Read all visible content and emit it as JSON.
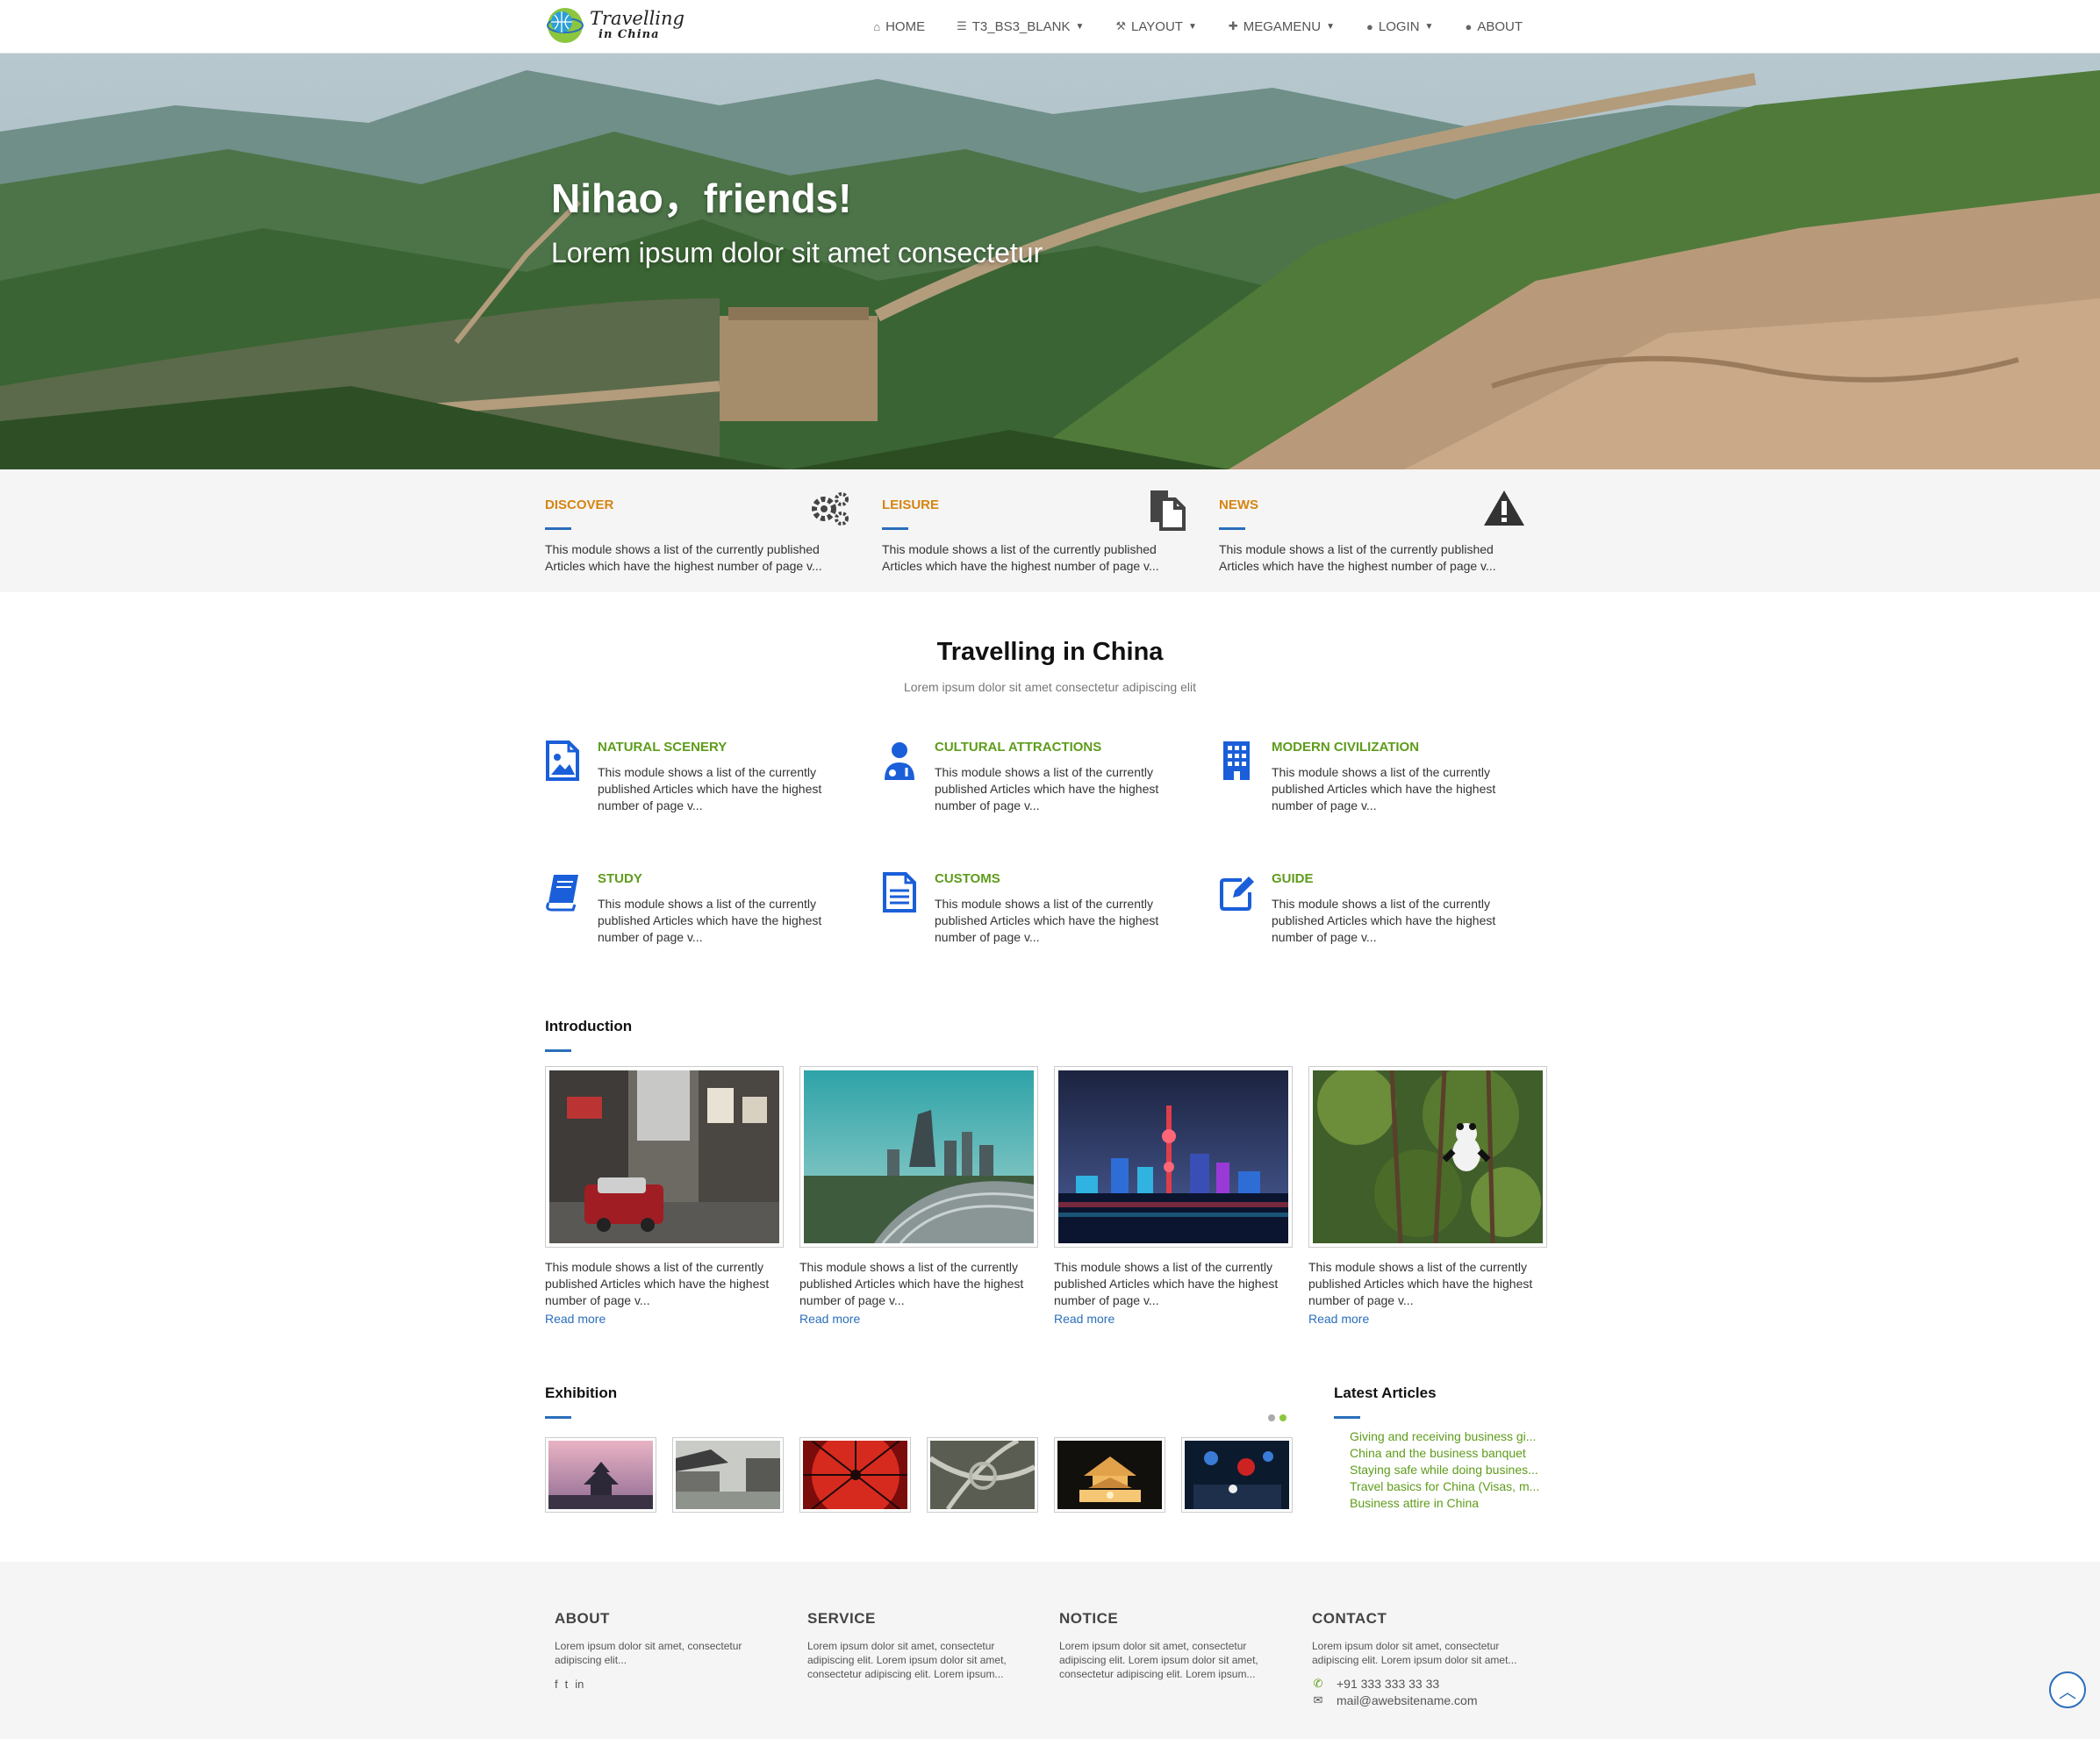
{
  "header": {
    "logo_line1": "Travelling",
    "logo_line2": "in China",
    "nav": [
      {
        "label": "HOME",
        "icon": "home-icon"
      },
      {
        "label": "T3_BS3_BLANK",
        "icon": "list-icon"
      },
      {
        "label": "LAYOUT",
        "icon": "wrench-icon"
      },
      {
        "label": "MEGAMENU",
        "icon": "gift-icon"
      },
      {
        "label": "LOGIN",
        "icon": "user-icon"
      },
      {
        "label": "ABOUT",
        "icon": "comment-icon"
      }
    ]
  },
  "hero": {
    "title": "Nihao，friends!",
    "subtitle": "Lorem ipsum dolor sit amet consectetur"
  },
  "strip": [
    {
      "title": "DISCOVER",
      "text": "This module shows a list of the currently published Articles which have the highest number of page v...",
      "icon": "gears-icon"
    },
    {
      "title": "LEISURE",
      "text": "This module shows a list of the currently published Articles which have the highest number of page v...",
      "icon": "documents-icon"
    },
    {
      "title": "NEWS",
      "text": "This module shows a list of the currently published Articles which have the highest number of page v...",
      "icon": "warning-icon"
    }
  ],
  "main": {
    "title": "Travelling in China",
    "subtitle": "Lorem ipsum dolor sit amet consectetur adipiscing elit"
  },
  "features": [
    {
      "title": "NATURAL SCENERY",
      "text": "This module shows a list of the currently published Articles which have the highest number of page v...",
      "icon": "picture-file-icon"
    },
    {
      "title": "CULTURAL ATTRACTIONS",
      "text": "This module shows a list of the currently published Articles which have the highest number of page v...",
      "icon": "user-doctor-icon"
    },
    {
      "title": "MODERN CIVILIZATION",
      "text": "This module shows a list of the currently published Articles which have the highest number of page v...",
      "icon": "building-icon"
    },
    {
      "title": "STUDY",
      "text": "This module shows a list of the currently published Articles which have the highest number of page v...",
      "icon": "book-icon"
    },
    {
      "title": "CUSTOMS",
      "text": "This module shows a list of the currently published Articles which have the highest number of page v...",
      "icon": "text-file-icon"
    },
    {
      "title": "GUIDE",
      "text": "This module shows a list of the currently published Articles which have the highest number of page v...",
      "icon": "edit-icon"
    }
  ],
  "introduction": {
    "title": "Introduction",
    "cards": [
      {
        "text": "This module shows a list of the currently published Articles which have the highest number of page v...",
        "more": "Read more"
      },
      {
        "text": "This module shows a list of the currently published Articles which have the highest number of page v...",
        "more": "Read more"
      },
      {
        "text": "This module shows a list of the currently published Articles which have the highest number of page v...",
        "more": "Read more"
      },
      {
        "text": "This module shows a list of the currently published Articles which have the highest number of page v...",
        "more": "Read more"
      }
    ]
  },
  "exhibition": {
    "title": "Exhibition"
  },
  "latest": {
    "title": "Latest Articles",
    "items": [
      "Giving and receiving business gi...",
      "China and the business banquet",
      "Staying safe while doing busines...",
      "Travel basics for China (Visas, m...",
      "Business attire in China"
    ]
  },
  "footer": {
    "about": {
      "title": "ABOUT",
      "text": "Lorem ipsum dolor sit amet, consectetur adipiscing elit..."
    },
    "service": {
      "title": "SERVICE",
      "text": "Lorem ipsum dolor sit amet, consectetur adipiscing elit. Lorem ipsum dolor sit amet, consectetur adipiscing elit. Lorem ipsum..."
    },
    "notice": {
      "title": "NOTICE",
      "text": "Lorem ipsum dolor sit amet, consectetur adipiscing elit. Lorem ipsum dolor sit amet, consectetur adipiscing elit. Lorem ipsum..."
    },
    "contact": {
      "title": "CONTACT",
      "text": "Lorem ipsum dolor sit amet, consectetur adipiscing elit. Lorem ipsum dolor sit amet...",
      "phone": "+91 333 333 33 33",
      "email": "mail@awebsitename.com"
    }
  },
  "colors": {
    "accent_orange": "#d58512",
    "accent_green": "#5e9c1b",
    "link_blue": "#2a6ebb",
    "icon_blue": "#1a5fd9"
  }
}
